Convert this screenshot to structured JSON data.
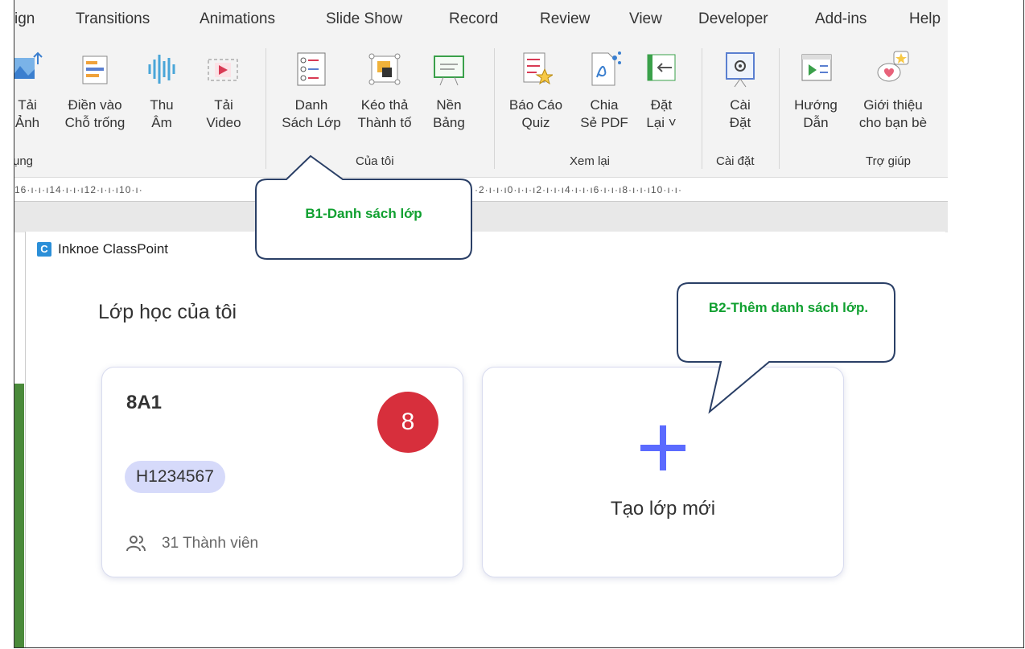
{
  "menu_tabs": [
    "ign",
    "Transitions",
    "Animations",
    "Slide Show",
    "Record",
    "Review",
    "View",
    "Developer",
    "Add-ins",
    "Help"
  ],
  "ribbon": {
    "buttons": [
      {
        "label1": "Tải",
        "label2": "Ảnh",
        "icon": "image-upload-icon"
      },
      {
        "label1": "Điền vào",
        "label2": "Chỗ trống",
        "icon": "fill-blank-icon"
      },
      {
        "label1": "Thu",
        "label2": "Âm",
        "icon": "audio-wave-icon"
      },
      {
        "label1": "Tải",
        "label2": "Video",
        "icon": "video-upload-icon"
      },
      {
        "label1": "Danh",
        "label2": "Sách Lớp",
        "icon": "class-list-icon"
      },
      {
        "label1": "Kéo thả",
        "label2": "Thành tố",
        "icon": "drag-drop-icon"
      },
      {
        "label1": "Nền",
        "label2": "Bảng",
        "icon": "whiteboard-icon"
      },
      {
        "label1": "Báo Cáo",
        "label2": "Quiz",
        "icon": "quiz-report-icon"
      },
      {
        "label1": "Chia",
        "label2": "Sẻ PDF",
        "icon": "share-pdf-icon"
      },
      {
        "label1": "Đặt",
        "label2": "Lại ˅",
        "icon": "reset-icon"
      },
      {
        "label1": "Cài",
        "label2": "Đặt",
        "icon": "settings-icon"
      },
      {
        "label1": "Hướng",
        "label2": "Dẫn",
        "icon": "tutorial-icon"
      },
      {
        "label1": "Giới thiệu",
        "label2": "cho bạn bè",
        "icon": "refer-friend-icon"
      }
    ],
    "groups": [
      "ụng",
      "Của tôi",
      "Xem lại",
      "Cài đặt",
      "Trợ giúp"
    ]
  },
  "ruler": "16·ı·ı·ı14·ı·ı·ı12·ı·ı·ı10·ı·",
  "ruler_right": "·2·ı·ı·ı0·ı·ı·ı2·ı·ı·ı4·ı·ı·ı6·ı·ı·ı8·ı·ı·ı10·ı·ı·",
  "dialog": {
    "app_title": "Inknoe ClassPoint",
    "logo_letter": "C",
    "heading": "Lớp học của tôi",
    "class_card": {
      "name": "8A1",
      "badge": "8",
      "code": "H1234567",
      "members": "31 Thành viên"
    },
    "new_class_label": "Tạo lớp mới"
  },
  "callouts": {
    "b1": "B1-Danh sách lớp",
    "b2": "B2-Thêm danh sách lớp."
  },
  "colors": {
    "badge": "#d72f3c",
    "code_chip": "#d6dafa",
    "plus": "#5b6bff",
    "callout_text": "#10a030",
    "callout_border": "#2a3f66"
  }
}
